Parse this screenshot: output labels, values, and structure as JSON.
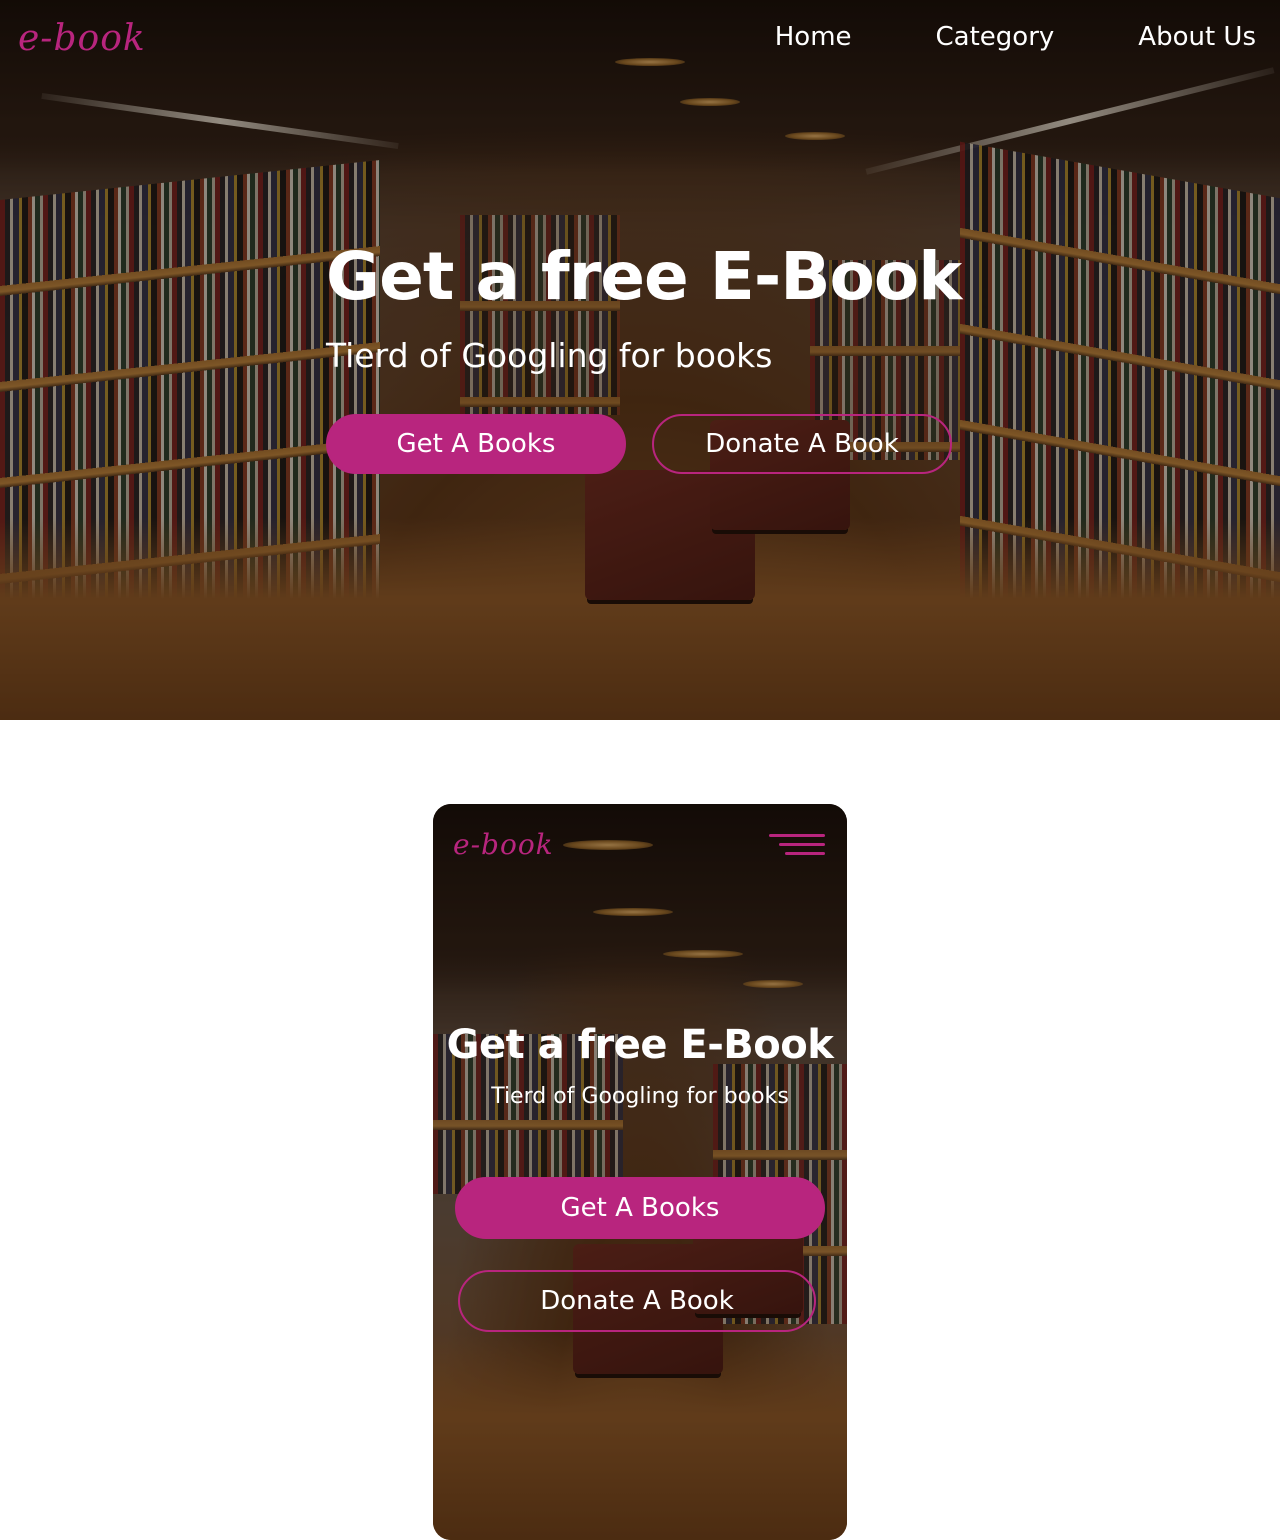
{
  "brand": {
    "logo_text": "e-book",
    "accent_color": "#b8257e"
  },
  "desktop": {
    "nav": [
      {
        "label": "Home"
      },
      {
        "label": "Category"
      },
      {
        "label": "About Us"
      }
    ],
    "hero": {
      "title": "Get a free E-Book",
      "subtitle": "Tierd of Googling for books",
      "primary_button": "Get A Books",
      "secondary_button": "Donate A Book"
    }
  },
  "mobile": {
    "menu_icon": "hamburger-menu-icon",
    "hero": {
      "title": "Get a free E-Book",
      "subtitle": "Tierd of Googling for books",
      "primary_button": "Get A Books",
      "secondary_button": "Donate A Book"
    }
  }
}
